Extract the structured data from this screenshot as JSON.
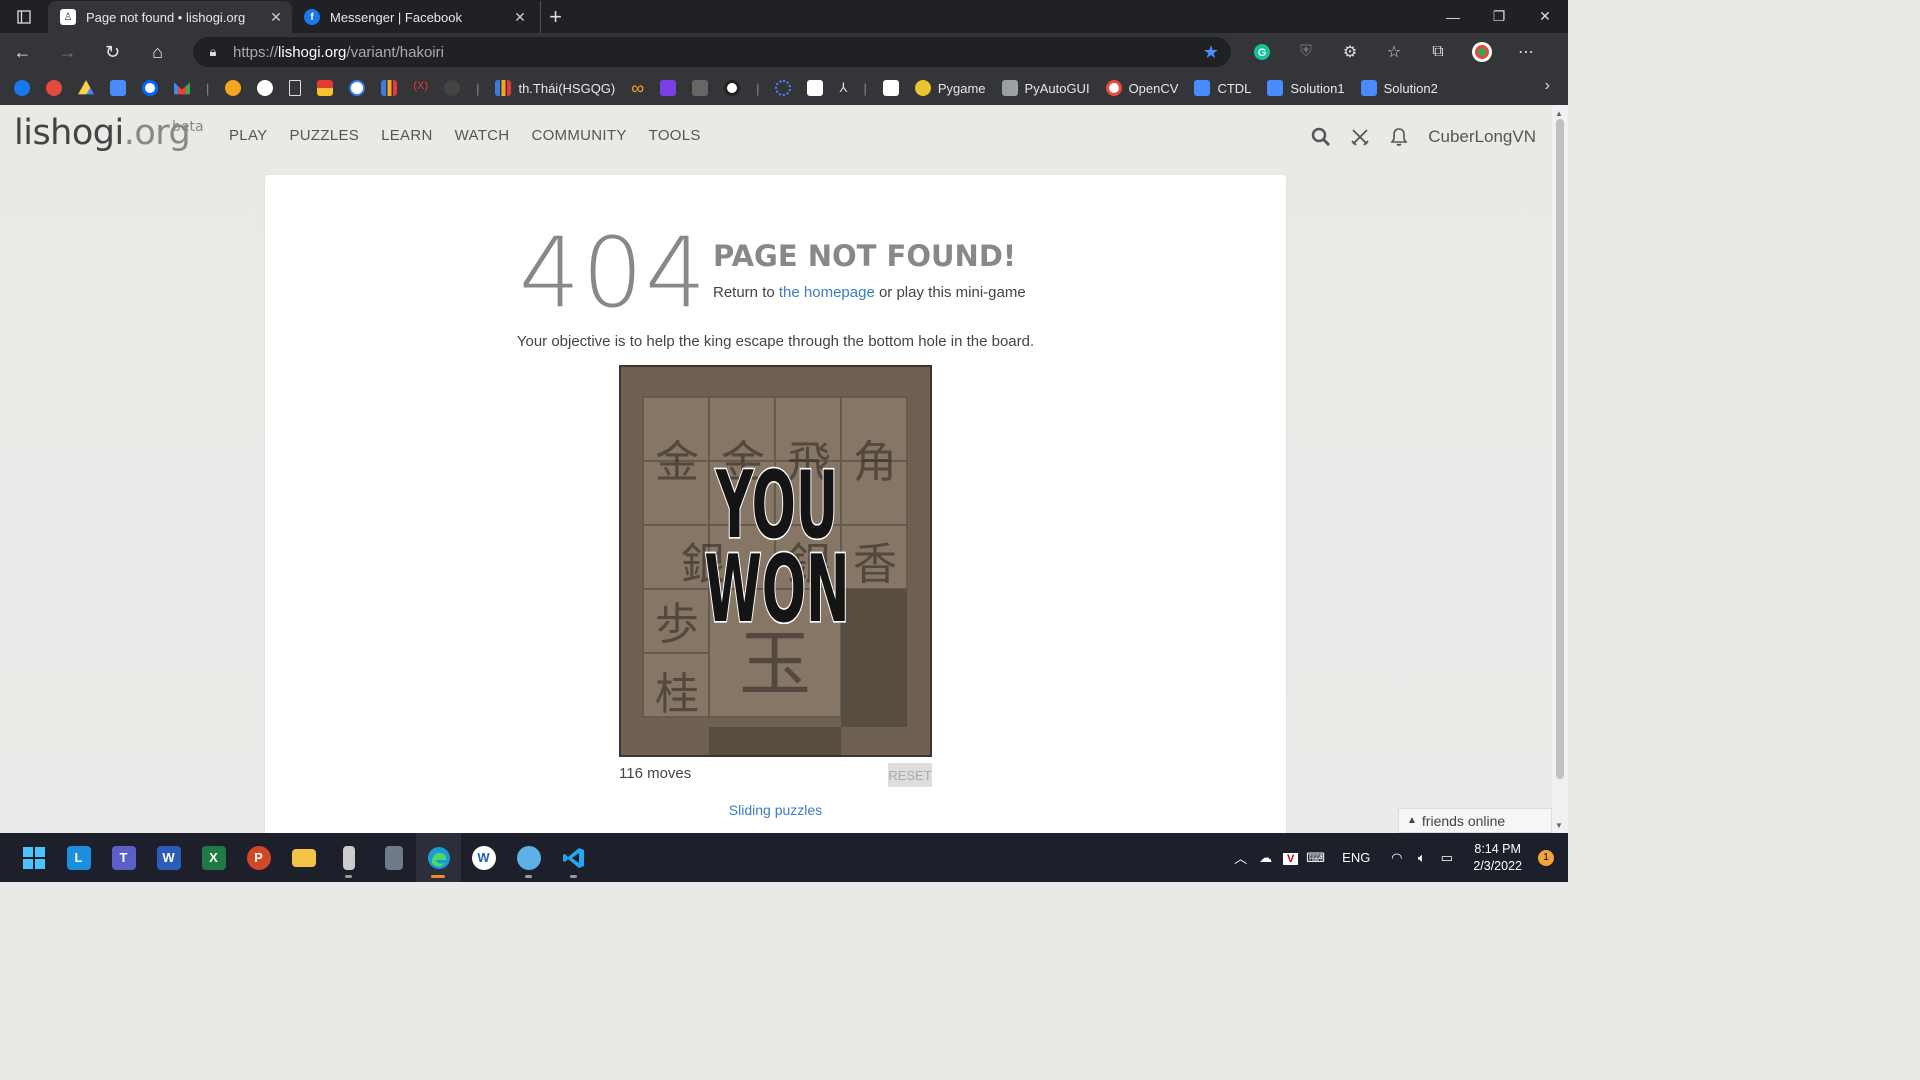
{
  "browser": {
    "tabs": [
      {
        "title": "Page not found • lishogi.org",
        "active": true,
        "favicon": "lishogi-favicon"
      },
      {
        "title": "Messenger | Facebook",
        "active": false,
        "favicon": "facebook-favicon"
      }
    ],
    "url_prefix": "https://",
    "url_domain": "lishogi.org",
    "url_path": "/variant/hakoiri",
    "bookmarks": [
      {
        "label": "th.Thái(HSGQG)",
        "color": "#3d7be0"
      },
      {
        "label": "Pygame",
        "color": "#e8c531"
      },
      {
        "label": "PyAutoGUI",
        "color": "#9aa0a6"
      },
      {
        "label": "OpenCV",
        "color": "#e84c3d"
      },
      {
        "label": "CTDL",
        "color": "#4a8cff"
      },
      {
        "label": "Solution1",
        "color": "#4a8cff"
      },
      {
        "label": "Solution2",
        "color": "#4a8cff"
      }
    ]
  },
  "site": {
    "logo_name": "lishogi",
    "logo_tld": ".org",
    "logo_badge": "beta",
    "nav": [
      "PLAY",
      "PUZZLES",
      "LEARN",
      "WATCH",
      "COMMUNITY",
      "TOOLS"
    ],
    "username": "CuberLongVN"
  },
  "error": {
    "code": "404",
    "title": "PAGE NOT FOUND!",
    "return_prefix": "Return to ",
    "return_link": "the homepage",
    "return_suffix": " or play this mini-game",
    "objective": "Your objective is to help the king escape through the bottom hole in the board."
  },
  "game": {
    "overlay_line1": "YOU",
    "overlay_line2": "WON",
    "pieces": [
      "金",
      "金",
      "飛",
      "角",
      "銀",
      "銀",
      "香",
      "歩",
      "玉",
      "桂"
    ],
    "moves_label": "116 moves",
    "reset_label": "RESET",
    "sliding_link": "Sliding puzzles"
  },
  "friends": {
    "label": "friends online"
  },
  "system": {
    "lang": "ENG",
    "time": "8:14 PM",
    "date": "2/3/2022",
    "notifications": "1"
  }
}
